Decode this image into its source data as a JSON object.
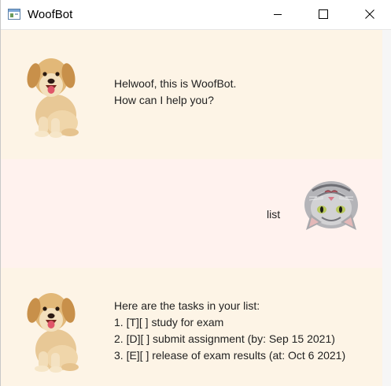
{
  "window": {
    "title": "WoofBot",
    "controls": {
      "minimize": "minimize-icon",
      "maximize": "maximize-icon",
      "close": "close-icon"
    }
  },
  "messages": [
    {
      "sender": "bot",
      "avatar": "puppy-avatar",
      "lines": [
        "Helwoof, this is WoofBot.",
        "How can I help you?"
      ]
    },
    {
      "sender": "user",
      "avatar": "cat-avatar",
      "lines": [
        "list"
      ]
    },
    {
      "sender": "bot",
      "avatar": "puppy-avatar",
      "lines": [
        "Here are the tasks in your list:",
        "1. [T][ ] study for exam",
        "2. [D][ ] submit assignment (by: Sep 15 2021)",
        "3. [E][ ] release of exam results (at: Oct 6 2021)"
      ]
    }
  ],
  "colors": {
    "bot_bubble": "#fdf4e6",
    "user_bubble": "#fff2ee"
  }
}
